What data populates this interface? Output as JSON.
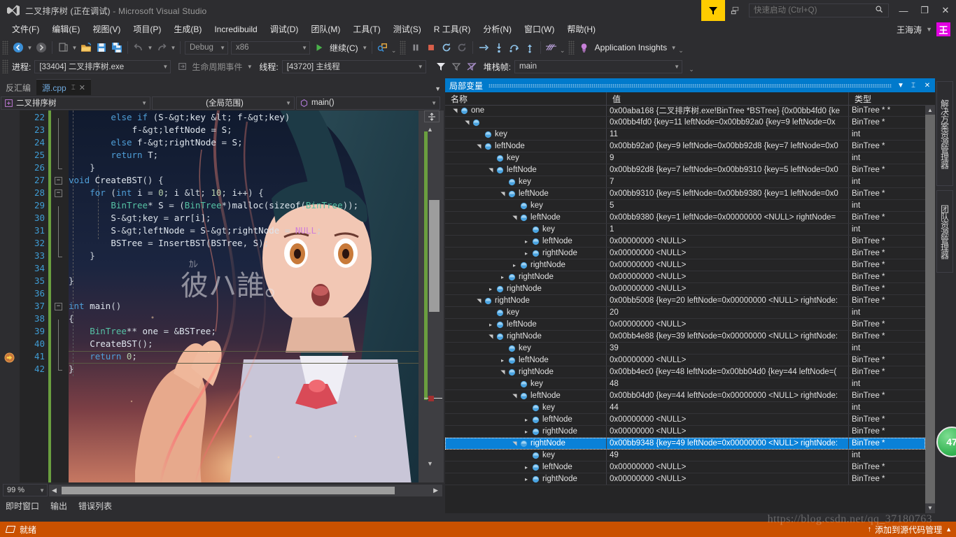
{
  "window": {
    "title_main": "二叉排序树 (正在调试)",
    "title_suffix": " - Microsoft Visual Studio",
    "minimize": "—",
    "restore": "❐",
    "close": "✕"
  },
  "menu": {
    "items": [
      {
        "label": "文件(F)"
      },
      {
        "label": "编辑(E)"
      },
      {
        "label": "视图(V)"
      },
      {
        "label": "项目(P)"
      },
      {
        "label": "生成(B)"
      },
      {
        "label": "Incredibuild"
      },
      {
        "label": "调试(D)"
      },
      {
        "label": "团队(M)"
      },
      {
        "label": "工具(T)"
      },
      {
        "label": "测试(S)"
      },
      {
        "label": "R 工具(R)"
      },
      {
        "label": "分析(N)"
      },
      {
        "label": "窗口(W)"
      },
      {
        "label": "帮助(H)"
      }
    ],
    "user_name": "王海涛",
    "user_initial": "王"
  },
  "quick_launch": {
    "placeholder": "快速启动 (Ctrl+Q)",
    "value": ""
  },
  "toolbar": {
    "config_combo": "Debug",
    "platform_combo": "x86",
    "continue_label": "继续(C)",
    "app_insights_label": "Application Insights",
    "icons": [
      "navigate-backward-icon",
      "navigate-forward-icon",
      "new-project-icon",
      "open-file-icon",
      "save-icon",
      "save-all-icon",
      "undo-icon",
      "redo-icon",
      "start-debug-icon",
      "attach-process-icon",
      "pause-icon",
      "stop-icon",
      "restart-icon",
      "restart-cycle-icon",
      "show-next-statement-icon",
      "step-into-icon",
      "step-over-icon",
      "step-out-icon",
      "threads-icon",
      "lightbulb-icon"
    ]
  },
  "debugbar": {
    "process_label": "进程:",
    "process_value": "[33404] 二叉排序树.exe",
    "lifecycle_label": "生命周期事件",
    "thread_label": "线程:",
    "thread_value": "[43720] 主线程",
    "stackframe_label": "堆栈帧:",
    "stackframe_value": "main"
  },
  "editor": {
    "tabs": [
      {
        "label": "反汇编",
        "active": false
      },
      {
        "label": "源.cpp",
        "active": true
      }
    ],
    "nav": {
      "project": "二叉排序树",
      "scope": "(全局范围)",
      "member": "main()"
    },
    "zoom": "99 %",
    "lines": [
      {
        "n": 22,
        "indent": 8,
        "text": "else if (S->key < f->key)"
      },
      {
        "n": 23,
        "indent": 12,
        "text": "f->leftNode = S;"
      },
      {
        "n": 24,
        "indent": 8,
        "text": "else f->rightNode = S;"
      },
      {
        "n": 25,
        "indent": 8,
        "text": "return T;"
      },
      {
        "n": 26,
        "indent": 4,
        "text": "}"
      },
      {
        "n": 27,
        "indent": 0,
        "text": "void CreateBST() {"
      },
      {
        "n": 28,
        "indent": 4,
        "text": "for (int i = 0; i < 10; i++) {"
      },
      {
        "n": 29,
        "indent": 8,
        "text": "BinTree* S = (BinTree*)malloc(sizeof(BinTree));"
      },
      {
        "n": 30,
        "indent": 8,
        "text": "S->key = arr[i];"
      },
      {
        "n": 31,
        "indent": 8,
        "text": "S->leftNode = S->rightNode = NULL;"
      },
      {
        "n": 32,
        "indent": 8,
        "text": "BSTree = InsertBST(BSTree, S);"
      },
      {
        "n": 33,
        "indent": 4,
        "text": "}"
      },
      {
        "n": 34,
        "indent": 0,
        "text": ""
      },
      {
        "n": 35,
        "indent": 0,
        "text": "}"
      },
      {
        "n": 36,
        "indent": 0,
        "text": ""
      },
      {
        "n": 37,
        "indent": 0,
        "text": "int main()"
      },
      {
        "n": 38,
        "indent": 0,
        "text": "{"
      },
      {
        "n": 39,
        "indent": 4,
        "text": "BinTree** one = &BSTree;"
      },
      {
        "n": 40,
        "indent": 4,
        "text": "CreateBST();"
      },
      {
        "n": 41,
        "indent": 4,
        "text": "return 0;"
      },
      {
        "n": 42,
        "indent": 0,
        "text": "}"
      }
    ],
    "current_line": 41,
    "breakpoint_line": 41
  },
  "bottom_tabs": [
    {
      "label": "即时窗口"
    },
    {
      "label": "输出"
    },
    {
      "label": "错误列表"
    }
  ],
  "locals": {
    "panel_title": "局部变量",
    "columns": [
      "名称",
      "值",
      "类型"
    ],
    "rows": [
      {
        "depth": 0,
        "tw": "down",
        "name": "one",
        "value": "0x00aba168 {二叉排序树.exe!BinTree  *BSTree} {0x00bb4fd0 {ke",
        "type": "BinTree * *",
        "sel": false
      },
      {
        "depth": 1,
        "tw": "down",
        "name": "",
        "value": "0x00bb4fd0 {key=11 leftNode=0x00bb92a0 {key=9 leftNode=0x",
        "type": "BinTree *",
        "sel": false
      },
      {
        "depth": 2,
        "tw": "none",
        "name": "key",
        "value": "11",
        "type": "int",
        "sel": false
      },
      {
        "depth": 2,
        "tw": "down",
        "name": "leftNode",
        "value": "0x00bb92a0 {key=9 leftNode=0x00bb92d8 {key=7 leftNode=0x0",
        "type": "BinTree *",
        "sel": false
      },
      {
        "depth": 3,
        "tw": "none",
        "name": "key",
        "value": "9",
        "type": "int",
        "sel": false
      },
      {
        "depth": 3,
        "tw": "down",
        "name": "leftNode",
        "value": "0x00bb92d8 {key=7 leftNode=0x00bb9310 {key=5 leftNode=0x0",
        "type": "BinTree *",
        "sel": false
      },
      {
        "depth": 4,
        "tw": "none",
        "name": "key",
        "value": "7",
        "type": "int",
        "sel": false
      },
      {
        "depth": 4,
        "tw": "down",
        "name": "leftNode",
        "value": "0x00bb9310 {key=5 leftNode=0x00bb9380 {key=1 leftNode=0x0",
        "type": "BinTree *",
        "sel": false
      },
      {
        "depth": 5,
        "tw": "none",
        "name": "key",
        "value": "5",
        "type": "int",
        "sel": false
      },
      {
        "depth": 5,
        "tw": "down",
        "name": "leftNode",
        "value": "0x00bb9380 {key=1 leftNode=0x00000000 <NULL> rightNode=",
        "type": "BinTree *",
        "sel": false
      },
      {
        "depth": 6,
        "tw": "none",
        "name": "key",
        "value": "1",
        "type": "int",
        "sel": false
      },
      {
        "depth": 6,
        "tw": "right",
        "name": "leftNode",
        "value": "0x00000000 <NULL>",
        "type": "BinTree *",
        "sel": false
      },
      {
        "depth": 6,
        "tw": "right",
        "name": "rightNode",
        "value": "0x00000000 <NULL>",
        "type": "BinTree *",
        "sel": false
      },
      {
        "depth": 5,
        "tw": "right",
        "name": "rightNode",
        "value": "0x00000000 <NULL>",
        "type": "BinTree *",
        "sel": false
      },
      {
        "depth": 4,
        "tw": "right",
        "name": "rightNode",
        "value": "0x00000000 <NULL>",
        "type": "BinTree *",
        "sel": false
      },
      {
        "depth": 3,
        "tw": "right",
        "name": "rightNode",
        "value": "0x00000000 <NULL>",
        "type": "BinTree *",
        "sel": false
      },
      {
        "depth": 2,
        "tw": "down",
        "name": "rightNode",
        "value": "0x00bb5008 {key=20 leftNode=0x00000000 <NULL> rightNode:",
        "type": "BinTree *",
        "sel": false
      },
      {
        "depth": 3,
        "tw": "none",
        "name": "key",
        "value": "20",
        "type": "int",
        "sel": false
      },
      {
        "depth": 3,
        "tw": "right",
        "name": "leftNode",
        "value": "0x00000000 <NULL>",
        "type": "BinTree *",
        "sel": false
      },
      {
        "depth": 3,
        "tw": "down",
        "name": "rightNode",
        "value": "0x00bb4e88 {key=39 leftNode=0x00000000 <NULL> rightNode:",
        "type": "BinTree *",
        "sel": false
      },
      {
        "depth": 4,
        "tw": "none",
        "name": "key",
        "value": "39",
        "type": "int",
        "sel": false
      },
      {
        "depth": 4,
        "tw": "right",
        "name": "leftNode",
        "value": "0x00000000 <NULL>",
        "type": "BinTree *",
        "sel": false
      },
      {
        "depth": 4,
        "tw": "down",
        "name": "rightNode",
        "value": "0x00bb4ec0 {key=48 leftNode=0x00bb04d0 {key=44 leftNode=(",
        "type": "BinTree *",
        "sel": false
      },
      {
        "depth": 5,
        "tw": "none",
        "name": "key",
        "value": "48",
        "type": "int",
        "sel": false
      },
      {
        "depth": 5,
        "tw": "down",
        "name": "leftNode",
        "value": "0x00bb04d0 {key=44 leftNode=0x00000000 <NULL> rightNode:",
        "type": "BinTree *",
        "sel": false
      },
      {
        "depth": 6,
        "tw": "none",
        "name": "key",
        "value": "44",
        "type": "int",
        "sel": false
      },
      {
        "depth": 6,
        "tw": "right",
        "name": "leftNode",
        "value": "0x00000000 <NULL>",
        "type": "BinTree *",
        "sel": false
      },
      {
        "depth": 6,
        "tw": "right",
        "name": "rightNode",
        "value": "0x00000000 <NULL>",
        "type": "BinTree *",
        "sel": false
      },
      {
        "depth": 5,
        "tw": "down",
        "name": "rightNode",
        "value": "0x00bb9348 {key=49 leftNode=0x00000000 <NULL> rightNode:",
        "type": "BinTree *",
        "sel": true
      },
      {
        "depth": 6,
        "tw": "none",
        "name": "key",
        "value": "49",
        "type": "int",
        "sel": false
      },
      {
        "depth": 6,
        "tw": "right",
        "name": "leftNode",
        "value": "0x00000000 <NULL>",
        "type": "BinTree *",
        "sel": false
      },
      {
        "depth": 6,
        "tw": "right",
        "name": "rightNode",
        "value": "0x00000000 <NULL>",
        "type": "BinTree *",
        "sel": false
      }
    ]
  },
  "rail": {
    "tabs": [
      {
        "label": "解决方案资源管理器"
      },
      {
        "label": "团队资源管理器"
      }
    ],
    "badge": "47"
  },
  "statusbar": {
    "ready": "就绪",
    "source_control": "添加到源代码管理",
    "watermark": "https://blog.csdn.net/qq_37180763"
  },
  "colors": {
    "accent": "#007acc",
    "status_orange": "#ca5100",
    "feedback_yellow": "#ffcc00",
    "avatar_magenta": "#e200e2",
    "editor_bg": "#1e1e1e",
    "chrome_bg": "#2d2d30"
  }
}
